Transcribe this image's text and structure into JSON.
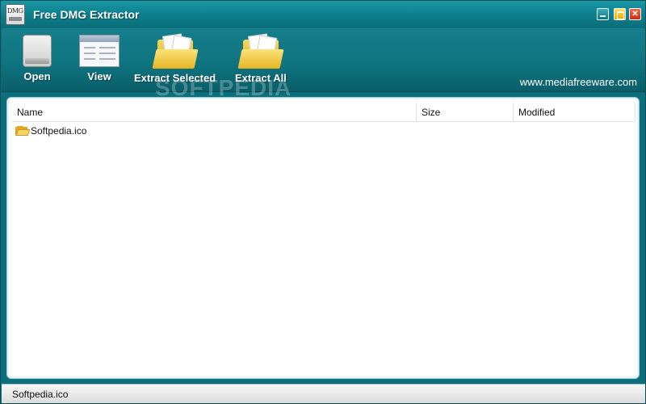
{
  "window": {
    "title": "Free DMG Extractor",
    "app_icon_text": "DMG"
  },
  "toolbar": {
    "open_label": "Open",
    "view_label": "View",
    "extract_selected_label": "Extract Selected",
    "extract_all_label": "Extract All",
    "website": "www.mediafreeware.com",
    "watermark": "SOFTPEDIA"
  },
  "list": {
    "columns": [
      "Name",
      "Size",
      "Modified"
    ],
    "rows": [
      {
        "name": "Softpedia.ico",
        "size": "",
        "modified": "",
        "icon": "folder-icon"
      }
    ]
  },
  "status": {
    "text": "Softpedia.ico"
  },
  "colors": {
    "accent": "#0d6f7b",
    "title_text": "#ffffff",
    "folder": "#e3a51c"
  }
}
